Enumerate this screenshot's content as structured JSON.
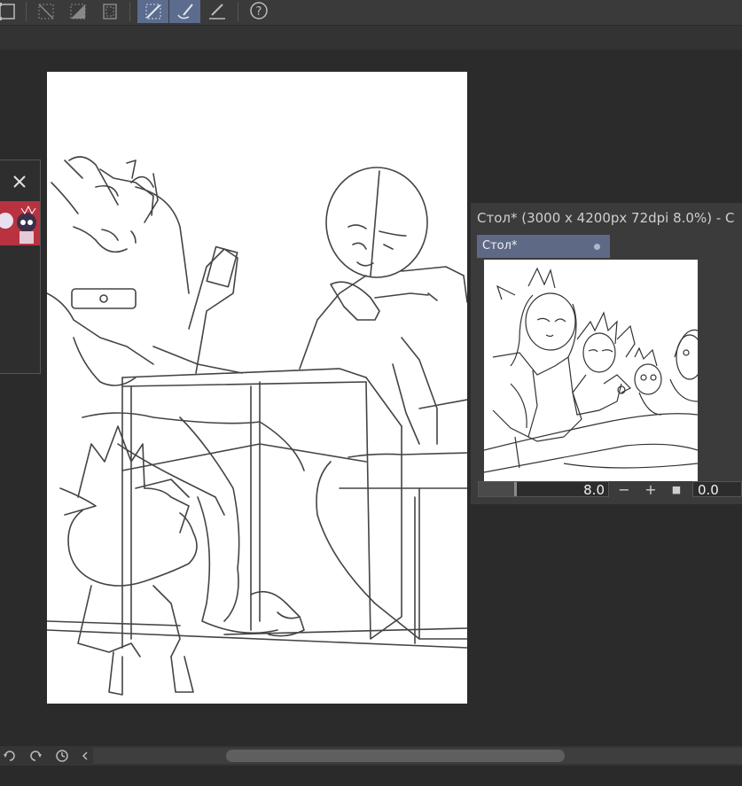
{
  "toolbar": {
    "icons": [
      "transform-icon",
      "select-none-icon",
      "invert-selection-icon",
      "marquee-icon",
      "pen-icon",
      "eraser-brush-icon",
      "ruler-pen-icon",
      "help-icon"
    ]
  },
  "navigator": {
    "title": "Стол* (3000 x 4200px 72dpi 8.0%)  - C",
    "tab_label": "Стол*",
    "zoom_value": "8.0",
    "zoom_minus": "−",
    "zoom_plus": "+",
    "zoom_reset": "■",
    "rotation_value": "0.0"
  },
  "left_panel": {
    "close_icon": "close-icon"
  },
  "bottom_bar": {
    "icons": [
      "undo-icon",
      "redo-icon",
      "history-icon",
      "scroll-left-icon"
    ]
  },
  "colors": {
    "bg": "#2b2b2b",
    "toolbar": "#3a3a3a",
    "accent": "#5b6c8e",
    "tab": "#5e6a85",
    "panel": "#3b3b3b"
  }
}
